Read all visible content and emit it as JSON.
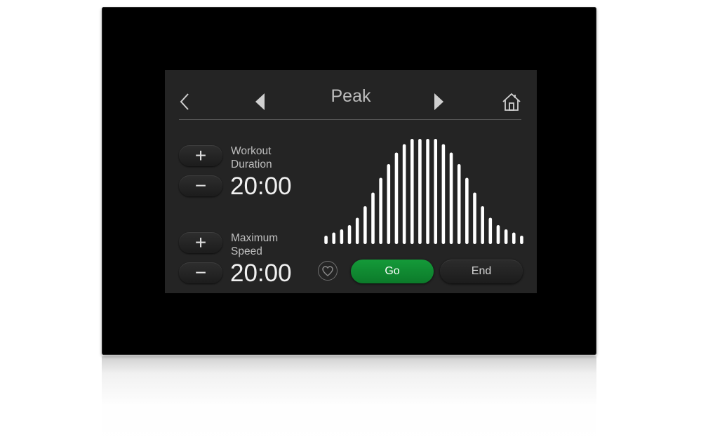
{
  "header": {
    "title": "Peak",
    "back_icon": "chevron-left-icon",
    "prev_icon": "triangle-left-icon",
    "next_icon": "triangle-right-icon",
    "home_icon": "home-icon"
  },
  "duration": {
    "label_line1": "Workout",
    "label_line2": "Duration",
    "value": "20:00",
    "increase_symbol": "+",
    "decrease_symbol": "−"
  },
  "speed": {
    "label_line1": "Maximum",
    "label_line2": "Speed",
    "value": "20:00",
    "increase_symbol": "+",
    "decrease_symbol": "−"
  },
  "actions": {
    "favorite_icon": "heart-icon",
    "go_label": "Go",
    "end_label": "End"
  },
  "colors": {
    "accent": "#119634",
    "screen_bg": "#242424",
    "bar_color": "#ffffff"
  },
  "chart_data": {
    "type": "bar",
    "values": [
      0.08,
      0.11,
      0.14,
      0.18,
      0.25,
      0.36,
      0.49,
      0.63,
      0.76,
      0.87,
      0.95,
      1.0,
      1.0,
      1.0,
      1.0,
      0.95,
      0.87,
      0.76,
      0.63,
      0.49,
      0.36,
      0.25,
      0.18,
      0.14,
      0.11,
      0.08
    ],
    "ylim": [
      0,
      1
    ]
  }
}
